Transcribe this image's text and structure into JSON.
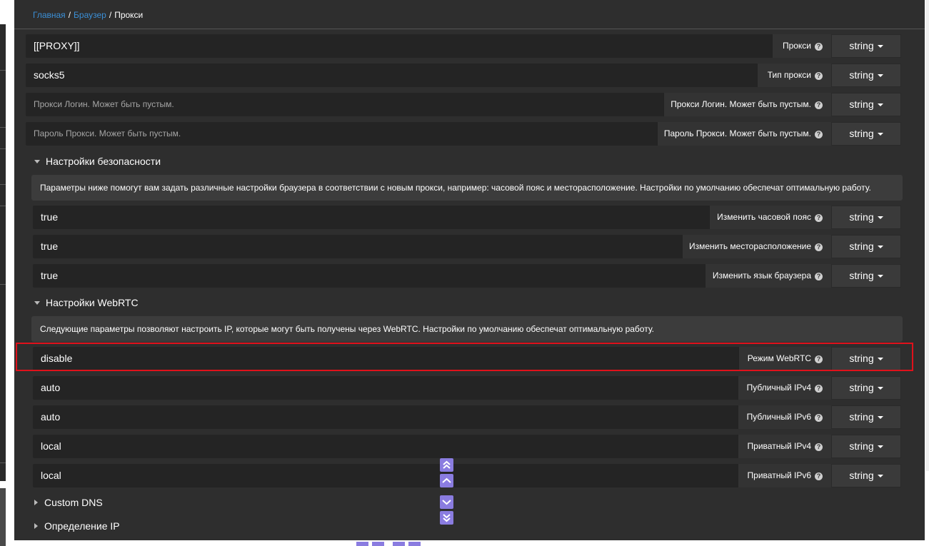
{
  "breadcrumb": {
    "home": "Главная",
    "sep1": "/",
    "browser": "Браузер",
    "sep2": "/",
    "current": "Прокси"
  },
  "proxy_rows": [
    {
      "value": "[[PROXY]]",
      "label": "Прокси",
      "type": "string"
    },
    {
      "value": "socks5",
      "label": "Тип прокси",
      "type": "string"
    },
    {
      "placeholder": "Прокси Логин. Может быть пустым.",
      "label": "Прокси Логин. Может быть пустым.",
      "type": "string"
    },
    {
      "placeholder": "Пароль Прокси. Может быть пустым.",
      "label": "Пароль Прокси. Может быть пустым.",
      "type": "string"
    }
  ],
  "security": {
    "title": "Настройки безопасности",
    "info": "Параметры ниже помогут вам задать различные настройки браузера в соответствии с новым прокси, например: часовой пояс и месторасположение. Настройки по умолчанию обеспечат оптимальную работу.",
    "rows": [
      {
        "value": "true",
        "label": "Изменить часовой пояс",
        "type": "string"
      },
      {
        "value": "true",
        "label": "Изменить месторасположение",
        "type": "string"
      },
      {
        "value": "true",
        "label": "Изменить язык браузера",
        "type": "string"
      }
    ]
  },
  "webrtc": {
    "title": "Настройки WebRTC",
    "info": "Следующие параметры позволяют настроить IP, которые могут быть получены через WebRTC. Настройки по умолчанию обеспечат оптимальную работу.",
    "rows": [
      {
        "value": "disable",
        "label": "Режим WebRTC",
        "type": "string"
      },
      {
        "value": "auto",
        "label": "Публичный IPv4",
        "type": "string"
      },
      {
        "value": "auto",
        "label": "Публичный IPv6",
        "type": "string"
      },
      {
        "value": "local",
        "label": "Приватный IPv4",
        "type": "string"
      },
      {
        "value": "local",
        "label": "Приватный IPv6",
        "type": "string"
      }
    ]
  },
  "collapsed_sections": {
    "dns": "Custom DNS",
    "ip": "Определение IP"
  },
  "help_glyph": "?",
  "colors": {
    "highlight": "#e0111b",
    "link": "#3b8fd6",
    "scroll_buttons": "#8a7ce0"
  },
  "icons": [
    "help-icon",
    "caret-down-icon",
    "triangle-down-icon",
    "triangle-right-icon",
    "scroll-top-icon",
    "scroll-up-icon",
    "scroll-down-icon",
    "scroll-bottom-icon"
  ]
}
